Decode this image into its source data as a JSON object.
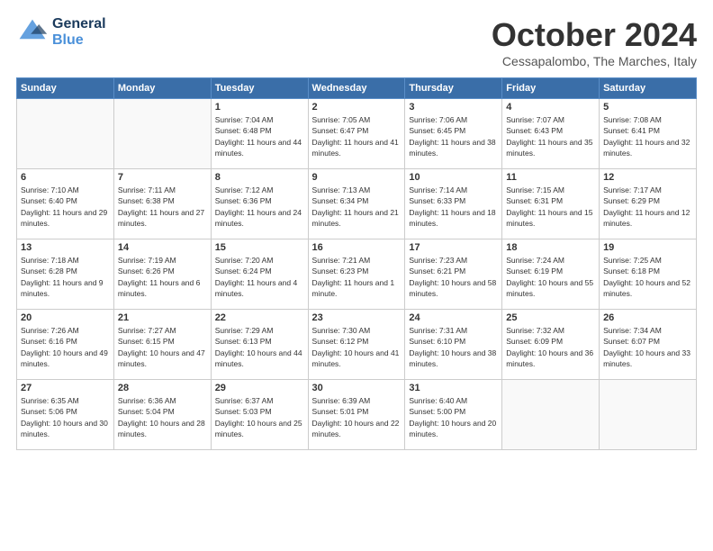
{
  "header": {
    "logo_general": "General",
    "logo_blue": "Blue",
    "month_title": "October 2024",
    "location": "Cessapalombo, The Marches, Italy"
  },
  "weekdays": [
    "Sunday",
    "Monday",
    "Tuesday",
    "Wednesday",
    "Thursday",
    "Friday",
    "Saturday"
  ],
  "weeks": [
    [
      {
        "day": "",
        "info": ""
      },
      {
        "day": "",
        "info": ""
      },
      {
        "day": "1",
        "info": "Sunrise: 7:04 AM\nSunset: 6:48 PM\nDaylight: 11 hours and 44 minutes."
      },
      {
        "day": "2",
        "info": "Sunrise: 7:05 AM\nSunset: 6:47 PM\nDaylight: 11 hours and 41 minutes."
      },
      {
        "day": "3",
        "info": "Sunrise: 7:06 AM\nSunset: 6:45 PM\nDaylight: 11 hours and 38 minutes."
      },
      {
        "day": "4",
        "info": "Sunrise: 7:07 AM\nSunset: 6:43 PM\nDaylight: 11 hours and 35 minutes."
      },
      {
        "day": "5",
        "info": "Sunrise: 7:08 AM\nSunset: 6:41 PM\nDaylight: 11 hours and 32 minutes."
      }
    ],
    [
      {
        "day": "6",
        "info": "Sunrise: 7:10 AM\nSunset: 6:40 PM\nDaylight: 11 hours and 29 minutes."
      },
      {
        "day": "7",
        "info": "Sunrise: 7:11 AM\nSunset: 6:38 PM\nDaylight: 11 hours and 27 minutes."
      },
      {
        "day": "8",
        "info": "Sunrise: 7:12 AM\nSunset: 6:36 PM\nDaylight: 11 hours and 24 minutes."
      },
      {
        "day": "9",
        "info": "Sunrise: 7:13 AM\nSunset: 6:34 PM\nDaylight: 11 hours and 21 minutes."
      },
      {
        "day": "10",
        "info": "Sunrise: 7:14 AM\nSunset: 6:33 PM\nDaylight: 11 hours and 18 minutes."
      },
      {
        "day": "11",
        "info": "Sunrise: 7:15 AM\nSunset: 6:31 PM\nDaylight: 11 hours and 15 minutes."
      },
      {
        "day": "12",
        "info": "Sunrise: 7:17 AM\nSunset: 6:29 PM\nDaylight: 11 hours and 12 minutes."
      }
    ],
    [
      {
        "day": "13",
        "info": "Sunrise: 7:18 AM\nSunset: 6:28 PM\nDaylight: 11 hours and 9 minutes."
      },
      {
        "day": "14",
        "info": "Sunrise: 7:19 AM\nSunset: 6:26 PM\nDaylight: 11 hours and 6 minutes."
      },
      {
        "day": "15",
        "info": "Sunrise: 7:20 AM\nSunset: 6:24 PM\nDaylight: 11 hours and 4 minutes."
      },
      {
        "day": "16",
        "info": "Sunrise: 7:21 AM\nSunset: 6:23 PM\nDaylight: 11 hours and 1 minute."
      },
      {
        "day": "17",
        "info": "Sunrise: 7:23 AM\nSunset: 6:21 PM\nDaylight: 10 hours and 58 minutes."
      },
      {
        "day": "18",
        "info": "Sunrise: 7:24 AM\nSunset: 6:19 PM\nDaylight: 10 hours and 55 minutes."
      },
      {
        "day": "19",
        "info": "Sunrise: 7:25 AM\nSunset: 6:18 PM\nDaylight: 10 hours and 52 minutes."
      }
    ],
    [
      {
        "day": "20",
        "info": "Sunrise: 7:26 AM\nSunset: 6:16 PM\nDaylight: 10 hours and 49 minutes."
      },
      {
        "day": "21",
        "info": "Sunrise: 7:27 AM\nSunset: 6:15 PM\nDaylight: 10 hours and 47 minutes."
      },
      {
        "day": "22",
        "info": "Sunrise: 7:29 AM\nSunset: 6:13 PM\nDaylight: 10 hours and 44 minutes."
      },
      {
        "day": "23",
        "info": "Sunrise: 7:30 AM\nSunset: 6:12 PM\nDaylight: 10 hours and 41 minutes."
      },
      {
        "day": "24",
        "info": "Sunrise: 7:31 AM\nSunset: 6:10 PM\nDaylight: 10 hours and 38 minutes."
      },
      {
        "day": "25",
        "info": "Sunrise: 7:32 AM\nSunset: 6:09 PM\nDaylight: 10 hours and 36 minutes."
      },
      {
        "day": "26",
        "info": "Sunrise: 7:34 AM\nSunset: 6:07 PM\nDaylight: 10 hours and 33 minutes."
      }
    ],
    [
      {
        "day": "27",
        "info": "Sunrise: 6:35 AM\nSunset: 5:06 PM\nDaylight: 10 hours and 30 minutes."
      },
      {
        "day": "28",
        "info": "Sunrise: 6:36 AM\nSunset: 5:04 PM\nDaylight: 10 hours and 28 minutes."
      },
      {
        "day": "29",
        "info": "Sunrise: 6:37 AM\nSunset: 5:03 PM\nDaylight: 10 hours and 25 minutes."
      },
      {
        "day": "30",
        "info": "Sunrise: 6:39 AM\nSunset: 5:01 PM\nDaylight: 10 hours and 22 minutes."
      },
      {
        "day": "31",
        "info": "Sunrise: 6:40 AM\nSunset: 5:00 PM\nDaylight: 10 hours and 20 minutes."
      },
      {
        "day": "",
        "info": ""
      },
      {
        "day": "",
        "info": ""
      }
    ]
  ]
}
